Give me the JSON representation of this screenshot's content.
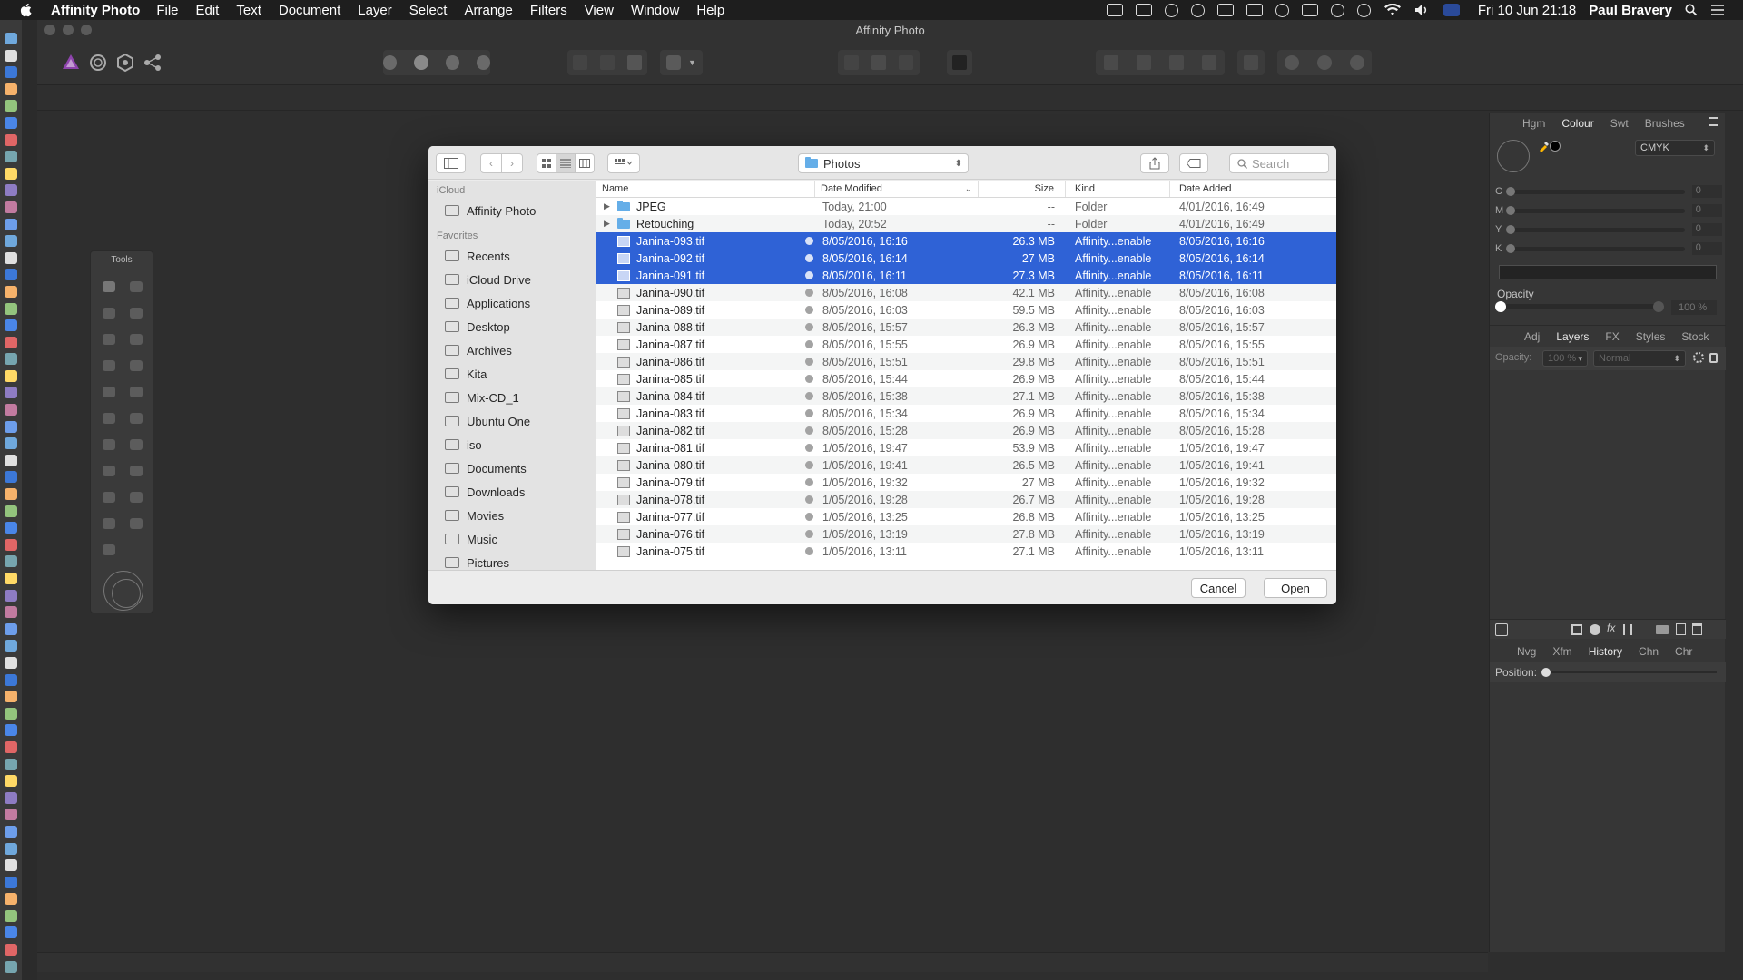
{
  "menubar": {
    "app_name": "Affinity Photo",
    "menus": [
      "File",
      "Edit",
      "Text",
      "Document",
      "Layer",
      "Select",
      "Arrange",
      "Filters",
      "View",
      "Window",
      "Help"
    ],
    "clock": "Fri 10 Jun  21:18",
    "user": "Paul Bravery"
  },
  "window": {
    "title": "Affinity Photo"
  },
  "tools_panel": {
    "title": "Tools"
  },
  "dialog": {
    "location": "Photos",
    "search_placeholder": "Search",
    "sidebar": {
      "icloud_heading": "iCloud",
      "icloud_items": [
        "Affinity Photo"
      ],
      "favorites_heading": "Favorites",
      "favorites": [
        "Recents",
        "iCloud Drive",
        "Applications",
        "Desktop",
        "Archives",
        "Kita",
        "Mix-CD_1",
        "Ubuntu One",
        "iso",
        "Documents",
        "Downloads",
        "Movies",
        "Music",
        "Pictures"
      ]
    },
    "columns": [
      "Name",
      "Date Modified",
      "Size",
      "Kind",
      "Date Added"
    ],
    "rows": [
      {
        "name": "JPEG",
        "modified": "Today, 21:00",
        "size": "--",
        "kind": "Folder",
        "added": "4/01/2016, 16:49",
        "folder": true,
        "selected": false
      },
      {
        "name": "Retouching",
        "modified": "Today, 20:52",
        "size": "--",
        "kind": "Folder",
        "added": "4/01/2016, 16:49",
        "folder": true,
        "selected": false
      },
      {
        "name": "Janina-093.tif",
        "modified": "8/05/2016, 16:16",
        "size": "26.3 MB",
        "kind": "Affinity...enable",
        "added": "8/05/2016, 16:16",
        "folder": false,
        "selected": true
      },
      {
        "name": "Janina-092.tif",
        "modified": "8/05/2016, 16:14",
        "size": "27 MB",
        "kind": "Affinity...enable",
        "added": "8/05/2016, 16:14",
        "folder": false,
        "selected": true
      },
      {
        "name": "Janina-091.tif",
        "modified": "8/05/2016, 16:11",
        "size": "27.3 MB",
        "kind": "Affinity...enable",
        "added": "8/05/2016, 16:11",
        "folder": false,
        "selected": true
      },
      {
        "name": "Janina-090.tif",
        "modified": "8/05/2016, 16:08",
        "size": "42.1 MB",
        "kind": "Affinity...enable",
        "added": "8/05/2016, 16:08",
        "folder": false,
        "selected": false
      },
      {
        "name": "Janina-089.tif",
        "modified": "8/05/2016, 16:03",
        "size": "59.5 MB",
        "kind": "Affinity...enable",
        "added": "8/05/2016, 16:03",
        "folder": false,
        "selected": false
      },
      {
        "name": "Janina-088.tif",
        "modified": "8/05/2016, 15:57",
        "size": "26.3 MB",
        "kind": "Affinity...enable",
        "added": "8/05/2016, 15:57",
        "folder": false,
        "selected": false
      },
      {
        "name": "Janina-087.tif",
        "modified": "8/05/2016, 15:55",
        "size": "26.9 MB",
        "kind": "Affinity...enable",
        "added": "8/05/2016, 15:55",
        "folder": false,
        "selected": false
      },
      {
        "name": "Janina-086.tif",
        "modified": "8/05/2016, 15:51",
        "size": "29.8 MB",
        "kind": "Affinity...enable",
        "added": "8/05/2016, 15:51",
        "folder": false,
        "selected": false
      },
      {
        "name": "Janina-085.tif",
        "modified": "8/05/2016, 15:44",
        "size": "26.9 MB",
        "kind": "Affinity...enable",
        "added": "8/05/2016, 15:44",
        "folder": false,
        "selected": false
      },
      {
        "name": "Janina-084.tif",
        "modified": "8/05/2016, 15:38",
        "size": "27.1 MB",
        "kind": "Affinity...enable",
        "added": "8/05/2016, 15:38",
        "folder": false,
        "selected": false
      },
      {
        "name": "Janina-083.tif",
        "modified": "8/05/2016, 15:34",
        "size": "26.9 MB",
        "kind": "Affinity...enable",
        "added": "8/05/2016, 15:34",
        "folder": false,
        "selected": false
      },
      {
        "name": "Janina-082.tif",
        "modified": "8/05/2016, 15:28",
        "size": "26.9 MB",
        "kind": "Affinity...enable",
        "added": "8/05/2016, 15:28",
        "folder": false,
        "selected": false
      },
      {
        "name": "Janina-081.tif",
        "modified": "1/05/2016, 19:47",
        "size": "53.9 MB",
        "kind": "Affinity...enable",
        "added": "1/05/2016, 19:47",
        "folder": false,
        "selected": false
      },
      {
        "name": "Janina-080.tif",
        "modified": "1/05/2016, 19:41",
        "size": "26.5 MB",
        "kind": "Affinity...enable",
        "added": "1/05/2016, 19:41",
        "folder": false,
        "selected": false
      },
      {
        "name": "Janina-079.tif",
        "modified": "1/05/2016, 19:32",
        "size": "27 MB",
        "kind": "Affinity...enable",
        "added": "1/05/2016, 19:32",
        "folder": false,
        "selected": false
      },
      {
        "name": "Janina-078.tif",
        "modified": "1/05/2016, 19:28",
        "size": "26.7 MB",
        "kind": "Affinity...enable",
        "added": "1/05/2016, 19:28",
        "folder": false,
        "selected": false
      },
      {
        "name": "Janina-077.tif",
        "modified": "1/05/2016, 13:25",
        "size": "26.8 MB",
        "kind": "Affinity...enable",
        "added": "1/05/2016, 13:25",
        "folder": false,
        "selected": false
      },
      {
        "name": "Janina-076.tif",
        "modified": "1/05/2016, 13:19",
        "size": "27.8 MB",
        "kind": "Affinity...enable",
        "added": "1/05/2016, 13:19",
        "folder": false,
        "selected": false
      },
      {
        "name": "Janina-075.tif",
        "modified": "1/05/2016, 13:11",
        "size": "27.1 MB",
        "kind": "Affinity...enable",
        "added": "1/05/2016, 13:11",
        "folder": false,
        "selected": false
      }
    ],
    "cancel_label": "Cancel",
    "open_label": "Open"
  },
  "colour_panel": {
    "tabs": [
      "Hgm",
      "Colour",
      "Swt",
      "Brushes"
    ],
    "active_tab": "Colour",
    "model": "CMYK",
    "channels": [
      {
        "label": "C",
        "value": "0"
      },
      {
        "label": "M",
        "value": "0"
      },
      {
        "label": "Y",
        "value": "0"
      },
      {
        "label": "K",
        "value": "0"
      }
    ],
    "opacity_label": "Opacity",
    "opacity_value": "100 %"
  },
  "layers_panel": {
    "tabs": [
      "Adj",
      "Layers",
      "FX",
      "Styles",
      "Stock"
    ],
    "active_tab": "Layers",
    "opacity_label": "Opacity:",
    "opacity_value": "100 %",
    "blend_mode": "Normal"
  },
  "history_panel": {
    "tabs": [
      "Nvg",
      "Xfm",
      "History",
      "Chn",
      "Chr"
    ],
    "active_tab": "History",
    "position_label": "Position:"
  },
  "colors": {
    "selection": "#2f62d6",
    "folder": "#65aee8",
    "app_bg": "#2b2b2b"
  }
}
